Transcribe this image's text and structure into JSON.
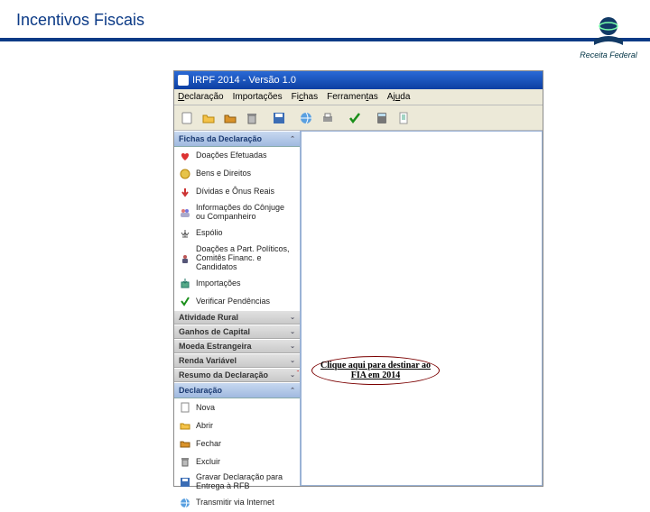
{
  "header": {
    "title": "Incentivos Fiscais",
    "brand": "Receita Federal"
  },
  "app": {
    "title": "IRPF 2014 - Versão 1.0",
    "menu": {
      "dec": "Declaração",
      "imp": "Importações",
      "fic": "Fichas",
      "ferr": "Ferramentas",
      "ajd": "Ajuda"
    },
    "sidebar": {
      "fichas_header": "Fichas da Declaração",
      "fichas": [
        {
          "label": "Doações Efetuadas"
        },
        {
          "label": "Bens e Direitos"
        },
        {
          "label": "Dívidas e Ônus Reais"
        },
        {
          "label": "Informações do Cônjuge ou Companheiro"
        },
        {
          "label": "Espólio"
        },
        {
          "label": "Doações a Part. Políticos, Comitês Financ. e Candidatos"
        },
        {
          "label": "Importações"
        },
        {
          "label": "Verificar Pendências"
        }
      ],
      "sections": [
        {
          "label": "Atividade Rural"
        },
        {
          "label": "Ganhos de Capital"
        },
        {
          "label": "Moeda Estrangeira"
        },
        {
          "label": "Renda Variável"
        },
        {
          "label": "Resumo da Declaração"
        }
      ],
      "declaracao_header": "Declaração",
      "declaracao": [
        {
          "label": "Nova"
        },
        {
          "label": "Abrir"
        },
        {
          "label": "Fechar"
        },
        {
          "label": "Excluir"
        },
        {
          "label": "Gravar Declaração para Entrega à RFB"
        },
        {
          "label": "Transmitir via Internet"
        }
      ]
    }
  },
  "callout": "Clique aqui para destinar ao FIA em 2014"
}
